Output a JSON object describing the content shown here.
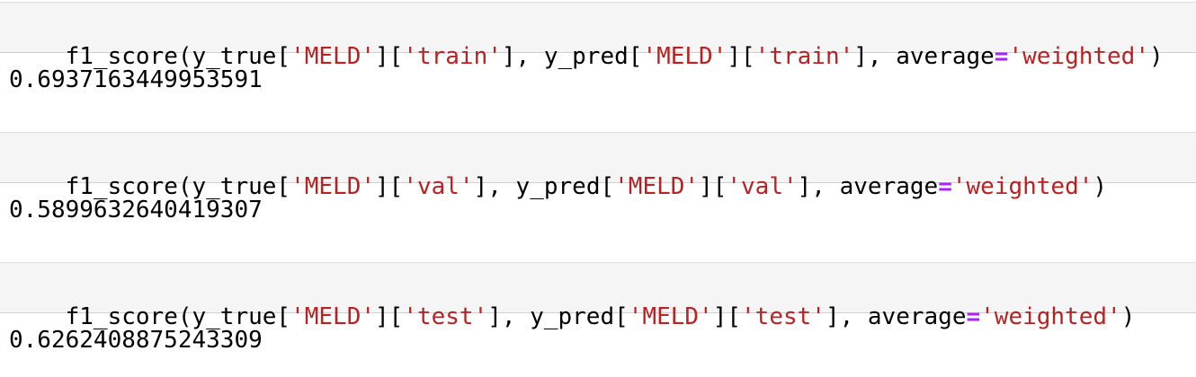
{
  "cells": [
    {
      "code_tokens": [
        {
          "t": "f1_score(y_true[",
          "k": "plain"
        },
        {
          "t": "'MELD'",
          "k": "str"
        },
        {
          "t": "][",
          "k": "plain"
        },
        {
          "t": "'train'",
          "k": "str"
        },
        {
          "t": "], y_pred[",
          "k": "plain"
        },
        {
          "t": "'MELD'",
          "k": "str"
        },
        {
          "t": "][",
          "k": "plain"
        },
        {
          "t": "'train'",
          "k": "str"
        },
        {
          "t": "], average",
          "k": "plain"
        },
        {
          "t": "=",
          "k": "op"
        },
        {
          "t": "'weighted'",
          "k": "str"
        },
        {
          "t": ")",
          "k": "plain"
        }
      ],
      "output": "0.6937163449953591"
    },
    {
      "code_tokens": [
        {
          "t": "f1_score(y_true[",
          "k": "plain"
        },
        {
          "t": "'MELD'",
          "k": "str"
        },
        {
          "t": "][",
          "k": "plain"
        },
        {
          "t": "'val'",
          "k": "str"
        },
        {
          "t": "], y_pred[",
          "k": "plain"
        },
        {
          "t": "'MELD'",
          "k": "str"
        },
        {
          "t": "][",
          "k": "plain"
        },
        {
          "t": "'val'",
          "k": "str"
        },
        {
          "t": "], average",
          "k": "plain"
        },
        {
          "t": "=",
          "k": "op"
        },
        {
          "t": "'weighted'",
          "k": "str"
        },
        {
          "t": ")",
          "k": "plain"
        }
      ],
      "output": "0.5899632640419307"
    },
    {
      "code_tokens": [
        {
          "t": "f1_score(y_true[",
          "k": "plain"
        },
        {
          "t": "'MELD'",
          "k": "str"
        },
        {
          "t": "][",
          "k": "plain"
        },
        {
          "t": "'test'",
          "k": "str"
        },
        {
          "t": "], y_pred[",
          "k": "plain"
        },
        {
          "t": "'MELD'",
          "k": "str"
        },
        {
          "t": "][",
          "k": "plain"
        },
        {
          "t": "'test'",
          "k": "str"
        },
        {
          "t": "], average",
          "k": "plain"
        },
        {
          "t": "=",
          "k": "op"
        },
        {
          "t": "'weighted'",
          "k": "str"
        },
        {
          "t": ")",
          "k": "plain"
        }
      ],
      "output": "0.6262408875243309"
    }
  ],
  "colors": {
    "string": "#ba2121",
    "operator": "#aa22ff",
    "plain": "#000000",
    "input_background": "#f5f5f5"
  }
}
